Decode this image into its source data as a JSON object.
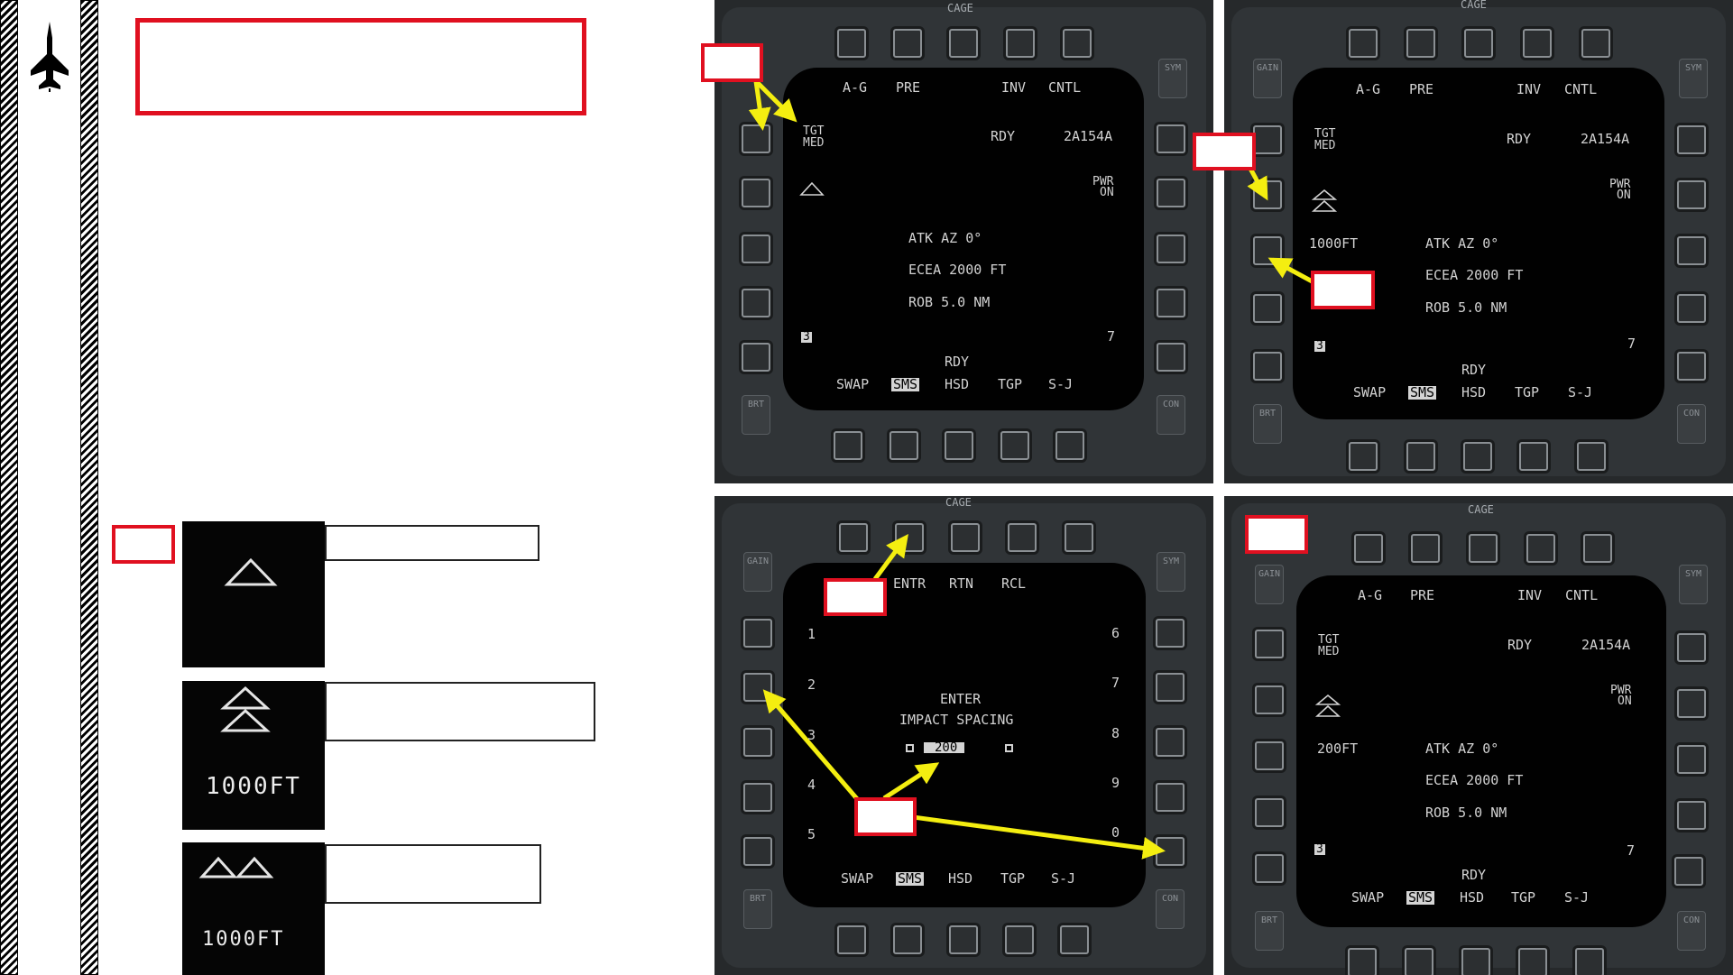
{
  "colors": {
    "callout_red": "#e01020",
    "arrow_yellow": "#f4ee10",
    "mfd_text": "#d2d2d2"
  },
  "sidebar": {
    "icon": "fighter-jet-icon"
  },
  "legend": [
    {
      "icon": "single-chevron-icon",
      "text": ""
    },
    {
      "icon": "double-chevron-icon",
      "text": "1000FT"
    },
    {
      "icon": "pair-chevron-icon",
      "text": "1000FT"
    }
  ],
  "mfds": [
    {
      "cage": "CAGE",
      "top_row": [
        "A-G",
        "PRE",
        "INV",
        "CNTL"
      ],
      "tgt": [
        "TGT",
        "MED"
      ],
      "rdy": "RDY",
      "id": "2A154A",
      "pwr": [
        "PWR",
        "ON"
      ],
      "dist": "",
      "info": [
        "ATK AZ 0°",
        "ECEA 2000 FT",
        "ROB 5.0 NM"
      ],
      "three": "3",
      "seven": "7",
      "rdy_bottom": "RDY",
      "bottom_row": [
        "SWAP",
        "SMS",
        "HSD",
        "TGP",
        "S-J"
      ]
    },
    {
      "cage": "CAGE",
      "top_row": [
        "A-G",
        "PRE",
        "INV",
        "CNTL"
      ],
      "tgt": [
        "TGT",
        "MED"
      ],
      "rdy": "RDY",
      "id": "2A154A",
      "pwr": [
        "PWR",
        "ON"
      ],
      "dist": "1000FT",
      "info": [
        "ATK AZ 0°",
        "ECEA 2000 FT",
        "ROB 5.0 NM"
      ],
      "three": "3",
      "seven": "7",
      "rdy_bottom": "RDY",
      "bottom_row": [
        "SWAP",
        "SMS",
        "HSD",
        "TGP",
        "S-J"
      ]
    },
    {
      "cage": "CAGE",
      "top_row": [
        "ENTR",
        "RTN",
        "RCL"
      ],
      "left_nums": [
        "1",
        "2",
        "3",
        "4",
        "5"
      ],
      "right_nums": [
        "6",
        "7",
        "8",
        "9",
        "0"
      ],
      "enter_lines": [
        "ENTER",
        "IMPACT SPACING"
      ],
      "value": "200",
      "bottom_row": [
        "SWAP",
        "SMS",
        "HSD",
        "TGP",
        "S-J"
      ]
    },
    {
      "cage": "CAGE",
      "top_row": [
        "A-G",
        "PRE",
        "INV",
        "CNTL"
      ],
      "tgt": [
        "TGT",
        "MED"
      ],
      "rdy": "RDY",
      "id": "2A154A",
      "pwr": [
        "PWR",
        "ON"
      ],
      "dist": "200FT",
      "info": [
        "ATK AZ 0°",
        "ECEA 2000 FT",
        "ROB 5.0 NM"
      ],
      "three": "3",
      "seven": "7",
      "rdy_bottom": "RDY",
      "bottom_row": [
        "SWAP",
        "SMS",
        "HSD",
        "TGP",
        "S-J"
      ]
    }
  ],
  "rocker_labels": {
    "gain": "GAIN",
    "sym": "SYM",
    "brt": "BRT",
    "con": "CON"
  }
}
